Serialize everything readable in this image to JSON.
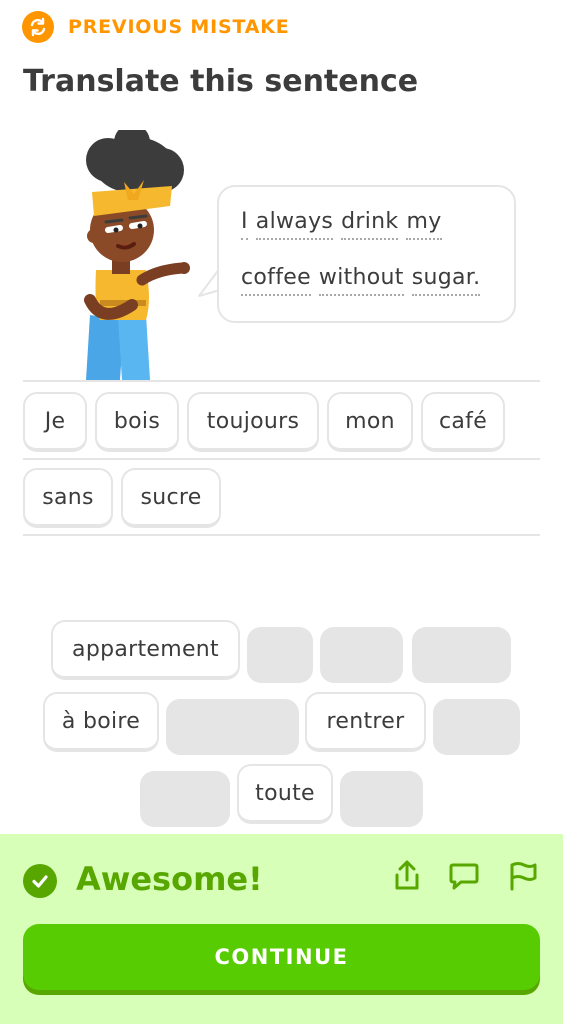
{
  "header": {
    "status_label": "PREVIOUS MISTAKE",
    "status_icon": "repeat-icon",
    "title": "Translate this sentence"
  },
  "prompt": {
    "words": [
      "I",
      "always",
      "drink",
      "my",
      "coffee",
      "without",
      "sugar."
    ]
  },
  "answer": {
    "tiles": [
      "Je",
      "bois",
      "toujours",
      "mon",
      "café",
      "sans",
      "sucre"
    ]
  },
  "word_bank": {
    "tiles": [
      "appartement",
      "à boire",
      "rentrer",
      "toute"
    ]
  },
  "feedback": {
    "result": "Awesome!",
    "icons": [
      "share-icon",
      "comment-icon",
      "flag-icon"
    ],
    "continue_label": "CONTINUE"
  },
  "colors": {
    "orange": "#ff9600",
    "green": "#58cc02",
    "green_dark": "#58a700",
    "footer_bg": "#d7ffb8",
    "tile_border": "#e5e5e5"
  }
}
